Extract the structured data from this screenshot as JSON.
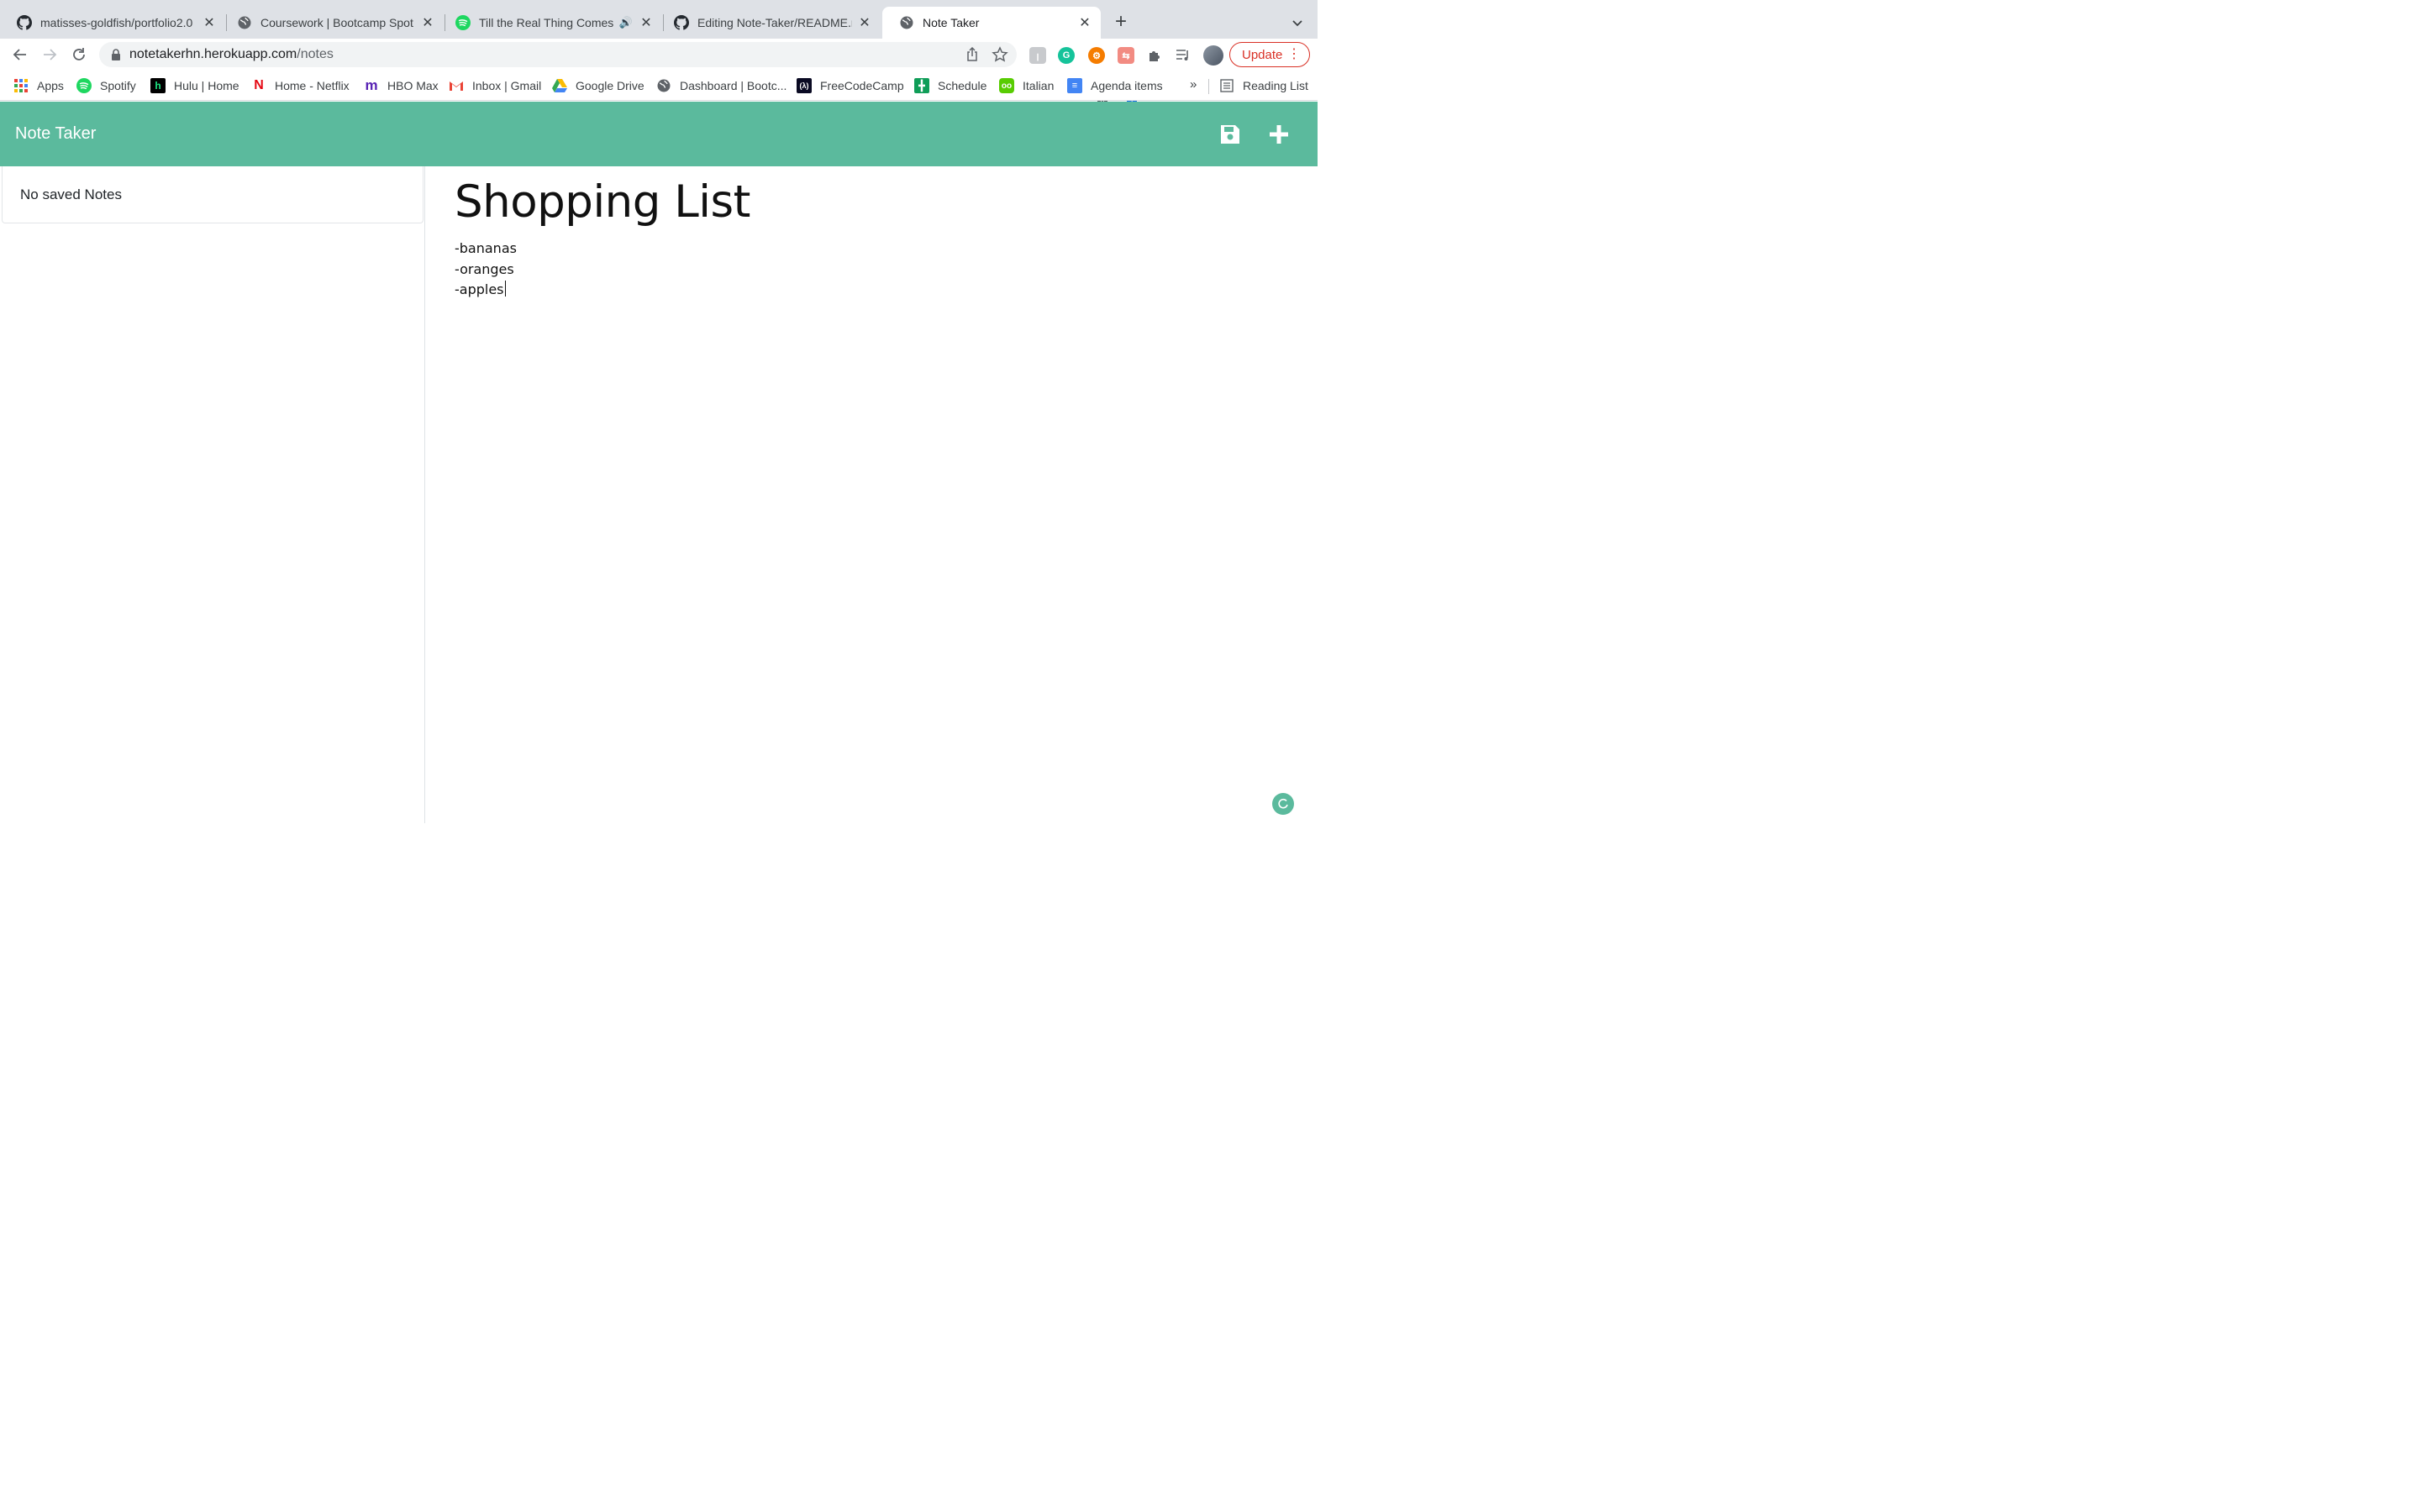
{
  "browser": {
    "tabs": [
      {
        "title": "matisses-goldfish/portfolio2.0",
        "icon": "github-icon"
      },
      {
        "title": "Coursework | Bootcamp Spot",
        "icon": "globe-icon"
      },
      {
        "title": "Till the Real Thing Comes A",
        "icon": "spotify-icon",
        "audio": true
      },
      {
        "title": "Editing Note-Taker/README.m",
        "icon": "github-icon"
      },
      {
        "title": "Note Taker",
        "icon": "globe-icon",
        "active": true
      }
    ],
    "address": {
      "host": "notetakerhn.herokuapp.com",
      "path": "/notes"
    },
    "extension_badges": {
      "first": "0",
      "second": "1"
    },
    "update_label": "Update",
    "bookmarks": [
      {
        "label": "Apps",
        "icon": "apps-grid-icon"
      },
      {
        "label": "Spotify",
        "icon": "spotify-icon"
      },
      {
        "label": "Hulu | Home",
        "icon": "hulu-icon"
      },
      {
        "label": "Home - Netflix",
        "icon": "netflix-icon"
      },
      {
        "label": "HBO Max",
        "icon": "hbo-max-icon"
      },
      {
        "label": "Inbox | Gmail",
        "icon": "gmail-icon"
      },
      {
        "label": "Google Drive",
        "icon": "google-drive-icon"
      },
      {
        "label": "Dashboard | Bootc...",
        "icon": "globe-icon"
      },
      {
        "label": "FreeCodeCamp",
        "icon": "freecodecamp-icon"
      },
      {
        "label": "Schedule",
        "icon": "sheets-icon"
      },
      {
        "label": "Italian",
        "icon": "duolingo-icon"
      },
      {
        "label": "Agenda items",
        "icon": "docs-icon"
      }
    ],
    "bookmarks_overflow": "»",
    "reading_list": "Reading List"
  },
  "app": {
    "title": "Note Taker",
    "accent_color": "#5bba9d",
    "sidebar": {
      "empty_message": "No saved Notes"
    },
    "note": {
      "title": "Shopping List",
      "lines": [
        "-bananas",
        "-oranges",
        "-apples"
      ]
    }
  }
}
